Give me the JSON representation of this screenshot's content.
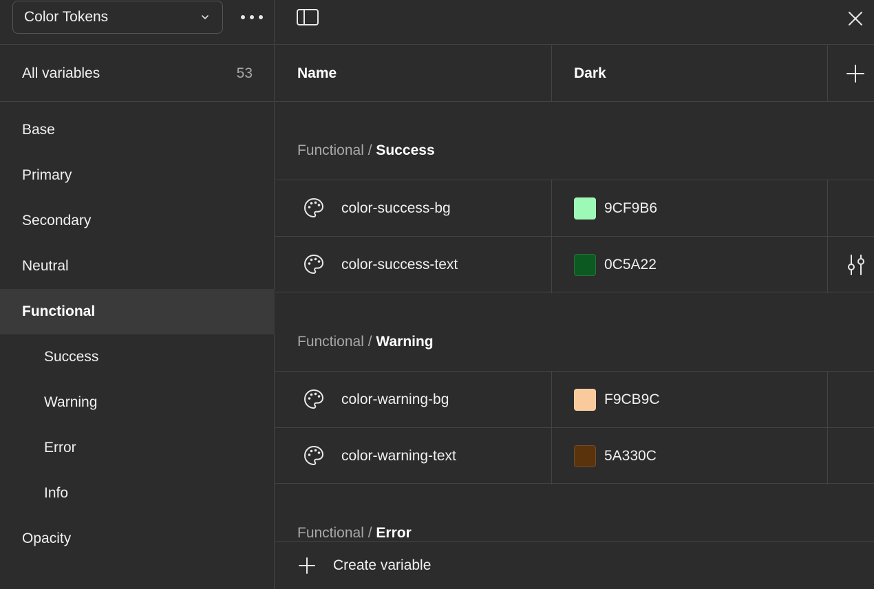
{
  "sidebar": {
    "collection": "Color Tokens",
    "all_variables_label": "All variables",
    "all_variables_count": "53",
    "groups": [
      {
        "label": "Base"
      },
      {
        "label": "Primary"
      },
      {
        "label": "Secondary"
      },
      {
        "label": "Neutral"
      },
      {
        "label": "Functional"
      },
      {
        "label": "Success"
      },
      {
        "label": "Warning"
      },
      {
        "label": "Error"
      },
      {
        "label": "Info"
      },
      {
        "label": "Opacity"
      }
    ]
  },
  "table": {
    "col_name": "Name",
    "col_dark": "Dark",
    "sections": [
      {
        "prefix": "Functional",
        "sep": "/",
        "name": "Success",
        "rows": [
          {
            "name": "color-success-bg",
            "hex": "9CF9B6",
            "color": "#9CF9B6"
          },
          {
            "name": "color-success-text",
            "hex": "0C5A22",
            "color": "#0C5A22"
          }
        ]
      },
      {
        "prefix": "Functional",
        "sep": "/",
        "name": "Warning",
        "rows": [
          {
            "name": "color-warning-bg",
            "hex": "F9CB9C",
            "color": "#F9CB9C"
          },
          {
            "name": "color-warning-text",
            "hex": "5A330C",
            "color": "#5A330C"
          }
        ]
      },
      {
        "prefix": "Functional",
        "sep": "/",
        "name": "Error",
        "rows": []
      }
    ]
  },
  "footer": {
    "create_label": "Create variable"
  }
}
